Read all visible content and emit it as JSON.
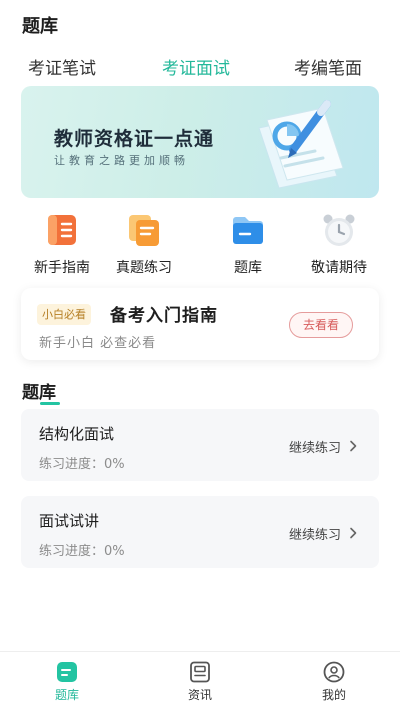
{
  "header": {
    "title": "题库"
  },
  "top_tabs": [
    {
      "label": "考证笔试",
      "active": false
    },
    {
      "label": "考证面试",
      "active": true
    },
    {
      "label": "考编笔面",
      "active": false
    }
  ],
  "banner": {
    "title": "教师资格证一点通",
    "subtitle": "让教育之路更加顺畅"
  },
  "quick_links": [
    {
      "label": "新手指南",
      "icon": "notebook-icon"
    },
    {
      "label": "真题练习",
      "icon": "documents-icon"
    },
    {
      "label": "题库",
      "icon": "folder-icon"
    },
    {
      "label": "敬请期待",
      "icon": "alarm-clock-icon"
    }
  ],
  "guide_card": {
    "badge": "小白必看",
    "title": "备考入门指南",
    "subtitle": "新手小白 必查必看",
    "button": "去看看"
  },
  "section": {
    "title": "题库"
  },
  "question_banks": [
    {
      "name": "结构化面试",
      "progress": "练习进度：0%",
      "action": "继续练习"
    },
    {
      "name": "面试试讲",
      "progress": "练习进度：0%",
      "action": "继续练习"
    }
  ],
  "bottom_nav": [
    {
      "label": "题库",
      "icon": "question-bank-icon",
      "active": true
    },
    {
      "label": "资讯",
      "icon": "news-icon",
      "active": false
    },
    {
      "label": "我的",
      "icon": "profile-icon",
      "active": false
    }
  ],
  "colors": {
    "accent": "#23b89a",
    "badge_text": "#b57e23",
    "button_red": "#d75c5c"
  }
}
